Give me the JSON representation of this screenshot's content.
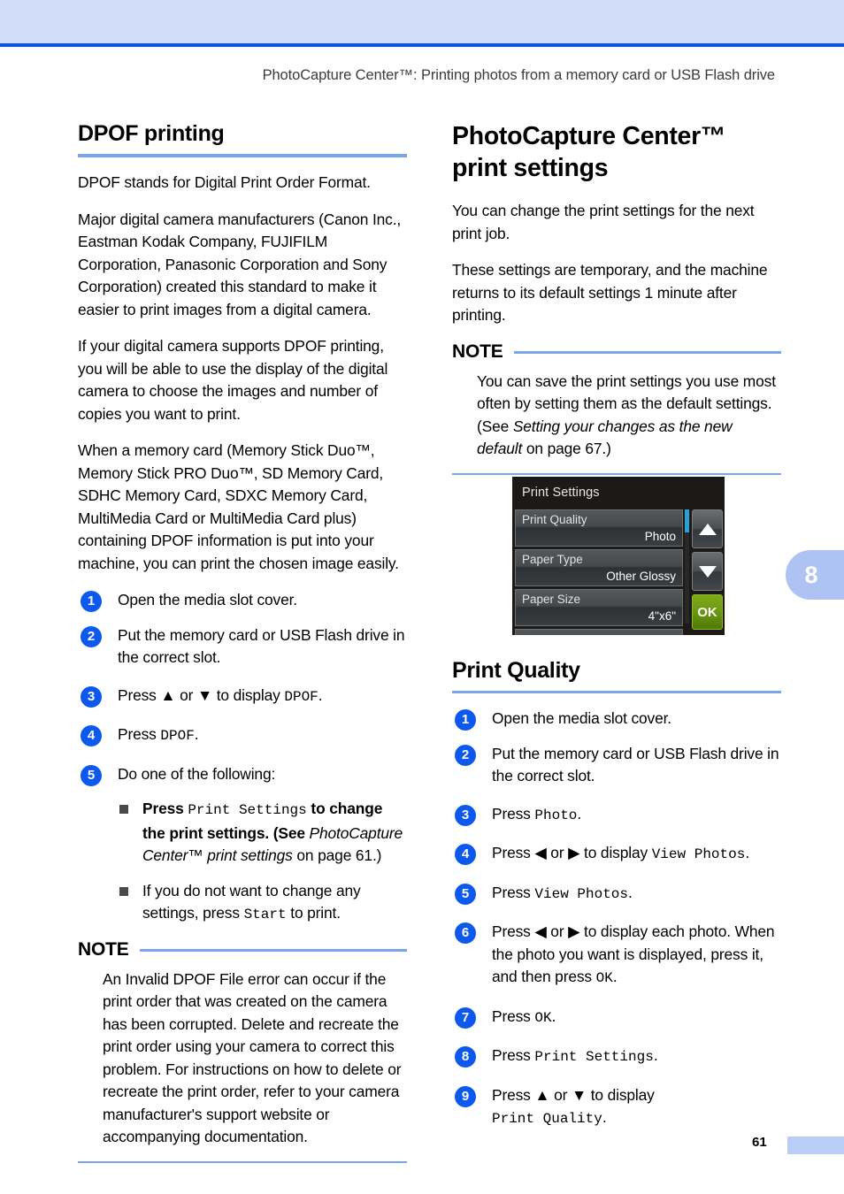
{
  "colors": {
    "header_band": "#d2ddfa",
    "header_rule": "#0a50f5",
    "section_rule": "#7ca4ea",
    "step_circle": "#0d59ee",
    "chapter_tab": "#aec3f4",
    "lcd_background": "#1d1917",
    "lcd_ok_green": "#6d9a12",
    "lcd_scroll_thumb": "#2a9fd6"
  },
  "header": {
    "running_head": "PhotoCapture Center™: Printing photos from a memory card or USB Flash drive"
  },
  "chapter_tab": {
    "number": "8"
  },
  "footer": {
    "page_number": "61"
  },
  "left_column": {
    "heading": "DPOF printing",
    "paragraphs": [
      "DPOF stands for Digital Print Order Format.",
      "Major digital camera manufacturers (Canon Inc., Eastman Kodak Company, FUJIFILM Corporation, Panasonic Corporation and Sony Corporation) created this standard to make it easier to print images from a digital camera.",
      "If your digital camera supports DPOF printing, you will be able to use the display of the digital camera to choose the images and number of copies you want to print.",
      "When a memory card (Memory Stick Duo™, Memory Stick PRO Duo™, SD Memory Card, SDHC Memory Card, SDXC Memory Card, MultiMedia Card or MultiMedia Card plus) containing DPOF information is put into your machine, you can print the chosen image easily."
    ],
    "steps": [
      {
        "num": "1",
        "text": "Open the media slot cover."
      },
      {
        "num": "2",
        "text": "Put the memory card or USB Flash drive in the correct slot."
      },
      {
        "num": "3",
        "text_pre": "Press ▲ or ▼ to display ",
        "mono": "DPOF",
        "text_post": "."
      },
      {
        "num": "4",
        "text_pre": "Press ",
        "mono": "DPOF",
        "text_post": "."
      },
      {
        "num": "5",
        "text": "Do one of the following:"
      }
    ],
    "bullets": [
      {
        "pre": "Press ",
        "mono": "Print Settings",
        "mid": " to change the print settings. (See ",
        "italic": "PhotoCapture Center™ print settings",
        "post": " on page 61.)"
      },
      {
        "pre": "If you do not want to change any settings, press ",
        "mono": "Start",
        "post": " to print."
      }
    ],
    "note": {
      "label": "NOTE",
      "body": "An Invalid DPOF File error can occur if the print order that was created on the camera has been corrupted. Delete and recreate the print order using your camera to correct this problem. For instructions on how to delete or recreate the print order, refer to your camera manufacturer's support website or accompanying documentation."
    }
  },
  "right_column": {
    "heading_line1": "PhotoCapture Center™",
    "heading_line2": "print settings",
    "paragraphs": [
      "You can change the print settings for the next print job.",
      "These settings are temporary, and the machine returns to its default settings 1 minute after printing."
    ],
    "note": {
      "label": "NOTE",
      "pre": "You can save the print settings you use most often by setting them as the default settings. (See ",
      "italic": "Setting your changes as the new default",
      "post": " on page 67.)"
    },
    "lcd": {
      "title": "Print Settings",
      "rows": [
        {
          "label": "Print Quality",
          "value": "Photo"
        },
        {
          "label": "Paper Type",
          "value": "Other Glossy"
        },
        {
          "label": "Paper Size",
          "value": "4\"x6\""
        }
      ],
      "up_button": "▲",
      "down_button": "▼",
      "ok_button": "OK"
    },
    "subheading": "Print Quality",
    "steps": [
      {
        "num": "1",
        "text": "Open the media slot cover."
      },
      {
        "num": "2",
        "text": "Put the memory card or USB Flash drive in the correct slot."
      },
      {
        "num": "3",
        "text_pre": "Press ",
        "mono": "Photo",
        "text_post": "."
      },
      {
        "num": "4",
        "text_pre": "Press ◀ or ▶ to display ",
        "mono": "View Photos",
        "text_post": "."
      },
      {
        "num": "5",
        "text_pre": "Press ",
        "mono": "View Photos",
        "text_post": "."
      },
      {
        "num": "6",
        "text_pre": "Press ◀ or ▶ to display each photo. When the photo you want is displayed, press it, and then press ",
        "mono": "OK",
        "text_post": "."
      },
      {
        "num": "7",
        "text_pre": "Press ",
        "mono": "OK",
        "text_post": "."
      },
      {
        "num": "8",
        "text_pre": "Press ",
        "mono": "Print Settings",
        "text_post": "."
      },
      {
        "num": "9",
        "text_pre": "Press ▲ or ▼ to display ",
        "mono": "Print Quality",
        "text_post": "."
      }
    ]
  }
}
